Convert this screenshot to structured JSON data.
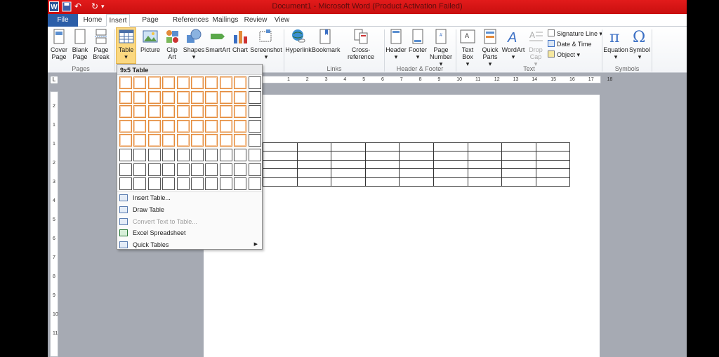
{
  "window": {
    "title": "Document1 - Microsoft Word (Product Activation Failed)"
  },
  "tabs": [
    {
      "label": "File"
    },
    {
      "label": "Home"
    },
    {
      "label": "Insert"
    },
    {
      "label": "Page Layout"
    },
    {
      "label": "References"
    },
    {
      "label": "Mailings"
    },
    {
      "label": "Review"
    },
    {
      "label": "View"
    }
  ],
  "ribbon": {
    "pages": {
      "cover_page": "Cover Page",
      "blank_page": "Blank Page",
      "page_break": "Page Break",
      "group": "Pages"
    },
    "tables": {
      "table": "Table"
    },
    "illustrations": {
      "picture": "Picture",
      "clip_art": "Clip Art",
      "shapes": "Shapes",
      "smartart": "SmartArt",
      "chart": "Chart",
      "screenshot": "Screenshot"
    },
    "links": {
      "hyperlink": "Hyperlink",
      "bookmark": "Bookmark",
      "cross_reference": "Cross-reference",
      "group": "Links"
    },
    "header_footer": {
      "header": "Header",
      "footer": "Footer",
      "page_number": "Page Number",
      "group": "Header & Footer"
    },
    "text": {
      "text_box": "Text Box",
      "quick_parts": "Quick Parts",
      "wordart": "WordArt",
      "drop_cap": "Drop Cap",
      "signature_line": "Signature Line",
      "date_time": "Date & Time",
      "object": "Object",
      "group": "Text"
    },
    "symbols": {
      "equation": "Equation",
      "symbol": "Symbol",
      "group": "Symbols"
    }
  },
  "table_menu": {
    "header": "9x5 Table",
    "selected_cols": 9,
    "selected_rows": 5,
    "grid_cols": 10,
    "grid_rows": 8,
    "items": [
      {
        "label": "Insert Table...",
        "icon": "table-icon",
        "disabled": false
      },
      {
        "label": "Draw Table",
        "icon": "pencil-icon",
        "disabled": false
      },
      {
        "label": "Convert Text to Table...",
        "icon": "convert-icon",
        "disabled": true
      },
      {
        "label": "Excel Spreadsheet",
        "icon": "excel-icon",
        "disabled": false
      },
      {
        "label": "Quick Tables",
        "icon": "quick-tables-icon",
        "disabled": false,
        "submenu": true
      }
    ]
  },
  "ruler": {
    "h_numbers": [
      "1",
      "2",
      "3",
      "4",
      "5",
      "6",
      "7",
      "8",
      "9",
      "10",
      "11",
      "12",
      "13",
      "14",
      "15",
      "16",
      "17",
      "18"
    ],
    "v_numbers": [
      "2",
      "1",
      "1",
      "2",
      "3",
      "4",
      "5",
      "6",
      "7",
      "8",
      "9",
      "10",
      "11"
    ]
  },
  "document": {
    "table_rows": 5,
    "table_cols": 9
  },
  "colors": {
    "title_bar": "#d41515",
    "file_tab": "#2b5ea8",
    "selection": "#fbd880",
    "grid_highlight": "#e38a3a"
  }
}
